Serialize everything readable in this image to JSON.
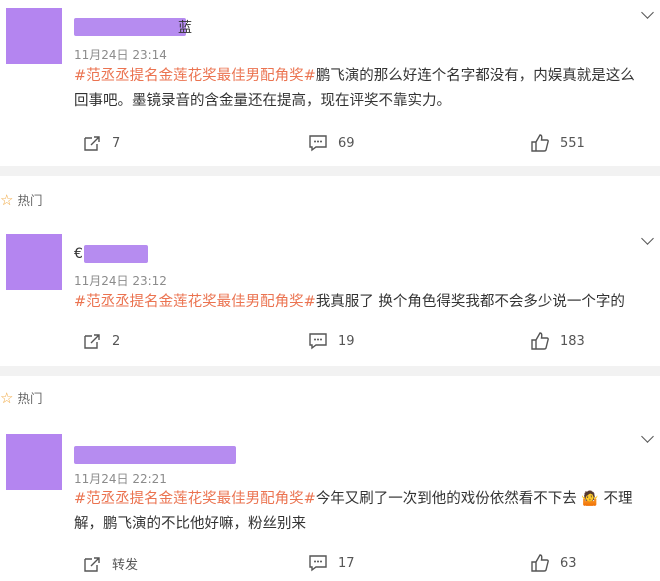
{
  "hashtag": "#范丞丞提名金莲花奖最佳男配角奖#",
  "hot_label": "热门",
  "comments": [
    {
      "name_visible": "",
      "name_tail": "蓝",
      "time": "11月24日 23:14",
      "text_lines": [
        "鹏飞演的那么好连个名字都没有，内娱真就是这么",
        "回事吧。墨镜录音的含金量还在提高，现在评奖不靠实力。"
      ],
      "repost": "7",
      "comment": "69",
      "like": "551"
    },
    {
      "name_visible": "€",
      "time": "11月24日 23:12",
      "text_lines": [
        "我真服了 换个角色得奖我都不会多少说一个字的"
      ],
      "repost": "2",
      "comment": "19",
      "like": "183"
    },
    {
      "name_visible": "",
      "time": "11月24日 22:21",
      "text_lines": [
        "今年又刷了一次到他的戏份依然看不下去",
        "解，鹏飞演的不比他好嘛，粉丝别来"
      ],
      "text_after_emoji": "不理",
      "emoji": "🤷",
      "repost": "转发",
      "comment": "17",
      "like": "63"
    }
  ]
}
